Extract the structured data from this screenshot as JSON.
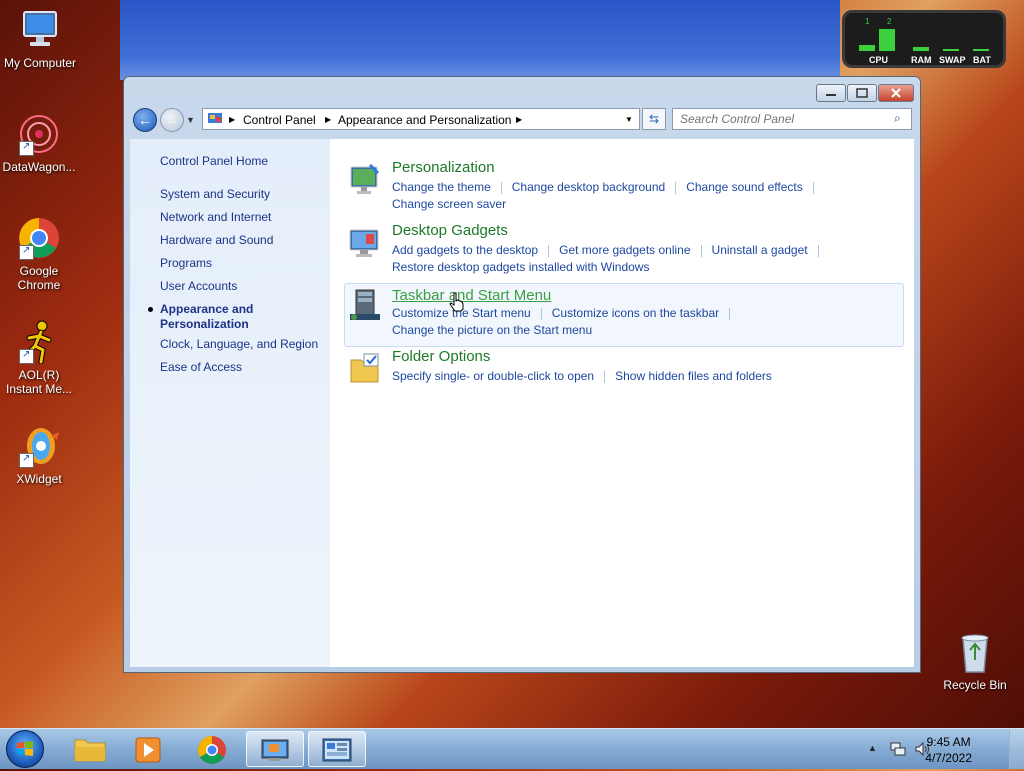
{
  "desktop": {
    "icons": [
      {
        "label": "My Computer"
      },
      {
        "label": "DataWagon..."
      },
      {
        "label": "Google Chrome"
      },
      {
        "label": "AOL(R) Instant Me..."
      },
      {
        "label": "XWidget"
      },
      {
        "label": "Recycle Bin"
      }
    ]
  },
  "meter": {
    "core1_label": "1",
    "core2_label": "2",
    "labels": [
      "CPU",
      "RAM",
      "SWAP",
      "BAT"
    ]
  },
  "window": {
    "breadcrumb": [
      "Control Panel",
      "Appearance and Personalization"
    ],
    "search_placeholder": "Search Control Panel",
    "sidebar": {
      "home": "Control Panel Home",
      "items": [
        "System and Security",
        "Network and Internet",
        "Hardware and Sound",
        "Programs",
        "User Accounts",
        "Appearance and",
        "Personalization",
        "Clock, Language, and Region",
        "Ease of Access"
      ]
    },
    "sections": [
      {
        "title": "Personalization",
        "links_row1": [
          "Change the theme",
          "Change desktop background",
          "Change sound effects"
        ],
        "links_row2": [
          "Change screen saver"
        ]
      },
      {
        "title": "Desktop Gadgets",
        "links_row1": [
          "Add gadgets to the desktop",
          "Get more gadgets online",
          "Uninstall a gadget"
        ],
        "links_row2": [
          "Restore desktop gadgets installed with Windows"
        ]
      },
      {
        "title": "Taskbar and Start Menu",
        "links_row1": [
          "Customize the Start menu",
          "Customize icons on the taskbar"
        ],
        "links_row2": [
          "Change the picture on the Start menu"
        ]
      },
      {
        "title": "Folder Options",
        "links_row1": [
          "Specify single- or double-click to open",
          "Show hidden files and folders"
        ],
        "links_row2": []
      }
    ]
  },
  "taskbar": {
    "time": "9:45 AM",
    "date": "4/7/2022"
  },
  "colors": {
    "link": "#1e48a0",
    "section_title": "#1e7a28",
    "sidebar_link": "#1e3287"
  }
}
